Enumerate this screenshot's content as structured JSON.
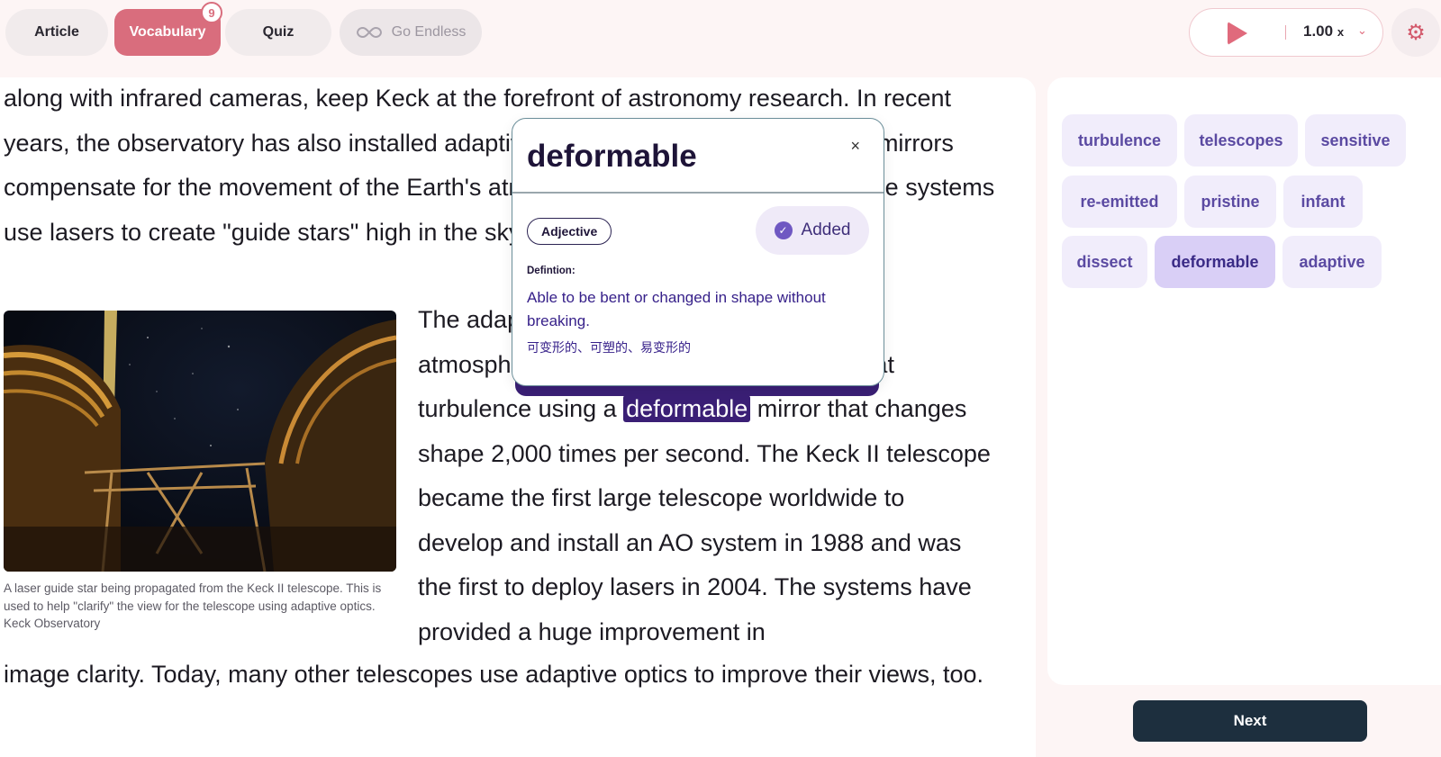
{
  "tabs": {
    "article": "Article",
    "vocabulary": "Vocabulary",
    "vocabulary_badge": "9",
    "quiz": "Quiz",
    "endless": "Go Endless"
  },
  "player": {
    "speed": "1.00",
    "speed_unit": "x"
  },
  "article": {
    "para_top": "along with infrared cameras, keep Keck at the forefront of astronomy research. In recent years, the observatory has also installed adaptive optics (AO) systems to help its mirrors compensate for the movement of the Earth's atmosphere that blurs the view. Those systems use lasers to create \"guide stars\" high in the sky.",
    "para_side_start": "The adaptive optics systems measure the atmosphere's turbulence and correct for that turbulence using a ",
    "highlight_word": "deformable",
    "para_side_end": " mirror that changes shape 2,000 times per second. The Keck II telescope became the first large telescope worldwide to develop and install an AO system in 1988 and was the first to deploy lasers in 2004. The systems have provided a huge improvement in",
    "para_bottom": "image clarity. Today, many other telescopes use adaptive optics to improve their views, too.",
    "caption": "A laser guide star being propagated from the Keck II telescope. This is used to help \"clarify\" the view for the telescope using adaptive optics. Keck Observatory"
  },
  "popup": {
    "word": "deformable",
    "close": "×",
    "part_of_speech": "Adjective",
    "added_label": "Added",
    "definition_label": "Defintion:",
    "definition": "Able to be bent or changed in shape without breaking.",
    "translation": "可变形的、可塑的、易变形的"
  },
  "vocab_chips": [
    "turbulence",
    "telescopes",
    "sensitive",
    "re-emitted",
    "pristine",
    "infant",
    "dissect",
    "deformable",
    "adaptive"
  ],
  "next_label": "Next",
  "colors": {
    "accent_pink": "#d96d7d",
    "highlight_purple": "#3a1f75",
    "chip_bg": "#f1edfb",
    "next_bg": "#1d2f3e"
  }
}
